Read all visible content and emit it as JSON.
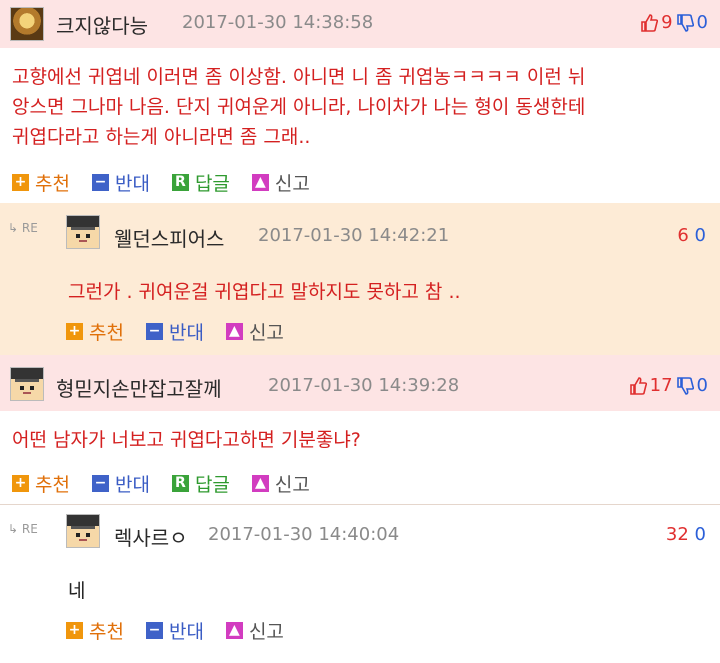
{
  "actions": {
    "recommend": "추천",
    "oppose": "반대",
    "reply": "답글",
    "report": "신고",
    "reply_icon": "R",
    "re_mark": "RE"
  },
  "comments": [
    {
      "type": "top",
      "nick": "크지않다능",
      "date": "2017-01-30 14:38:58",
      "up": "9",
      "down": "0",
      "lines": [
        "고향에선 귀엽네 이러면 좀 이상함. 아니면 니 좀 귀엽농ㅋㅋㅋㅋ 이런 뉘",
        "앙스면 그나마 나음. 단지 귀여운게 아니라, 나이차가 나는 형이 동생한테",
        "귀엽다라고 하는게 아니라면 좀 그래.."
      ]
    },
    {
      "type": "reply",
      "nick": "웰던스피어스",
      "date": "2017-01-30 14:42:21",
      "up": "6",
      "down": "0",
      "lines": [
        "그런가 . 귀여운걸 귀엽다고 말하지도 못하고 참 .."
      ]
    },
    {
      "type": "top",
      "nick": "형믿지손만잡고잘께",
      "date": "2017-01-30 14:39:28",
      "up": "17",
      "down": "0",
      "lines": [
        "어떤 남자가 너보고 귀엽다고하면 기분좋냐?"
      ]
    },
    {
      "type": "reply",
      "nick": "렉사르ㅇ",
      "date": "2017-01-30 14:40:04",
      "up": "32",
      "down": "0",
      "lines": [
        "네"
      ]
    }
  ],
  "colors": {
    "top_header_bg": "#fde4e4",
    "reply_bg": "#fdebd6",
    "body_text": "#d42020",
    "upvote": "#e03030",
    "downvote": "#2b5fd8"
  }
}
